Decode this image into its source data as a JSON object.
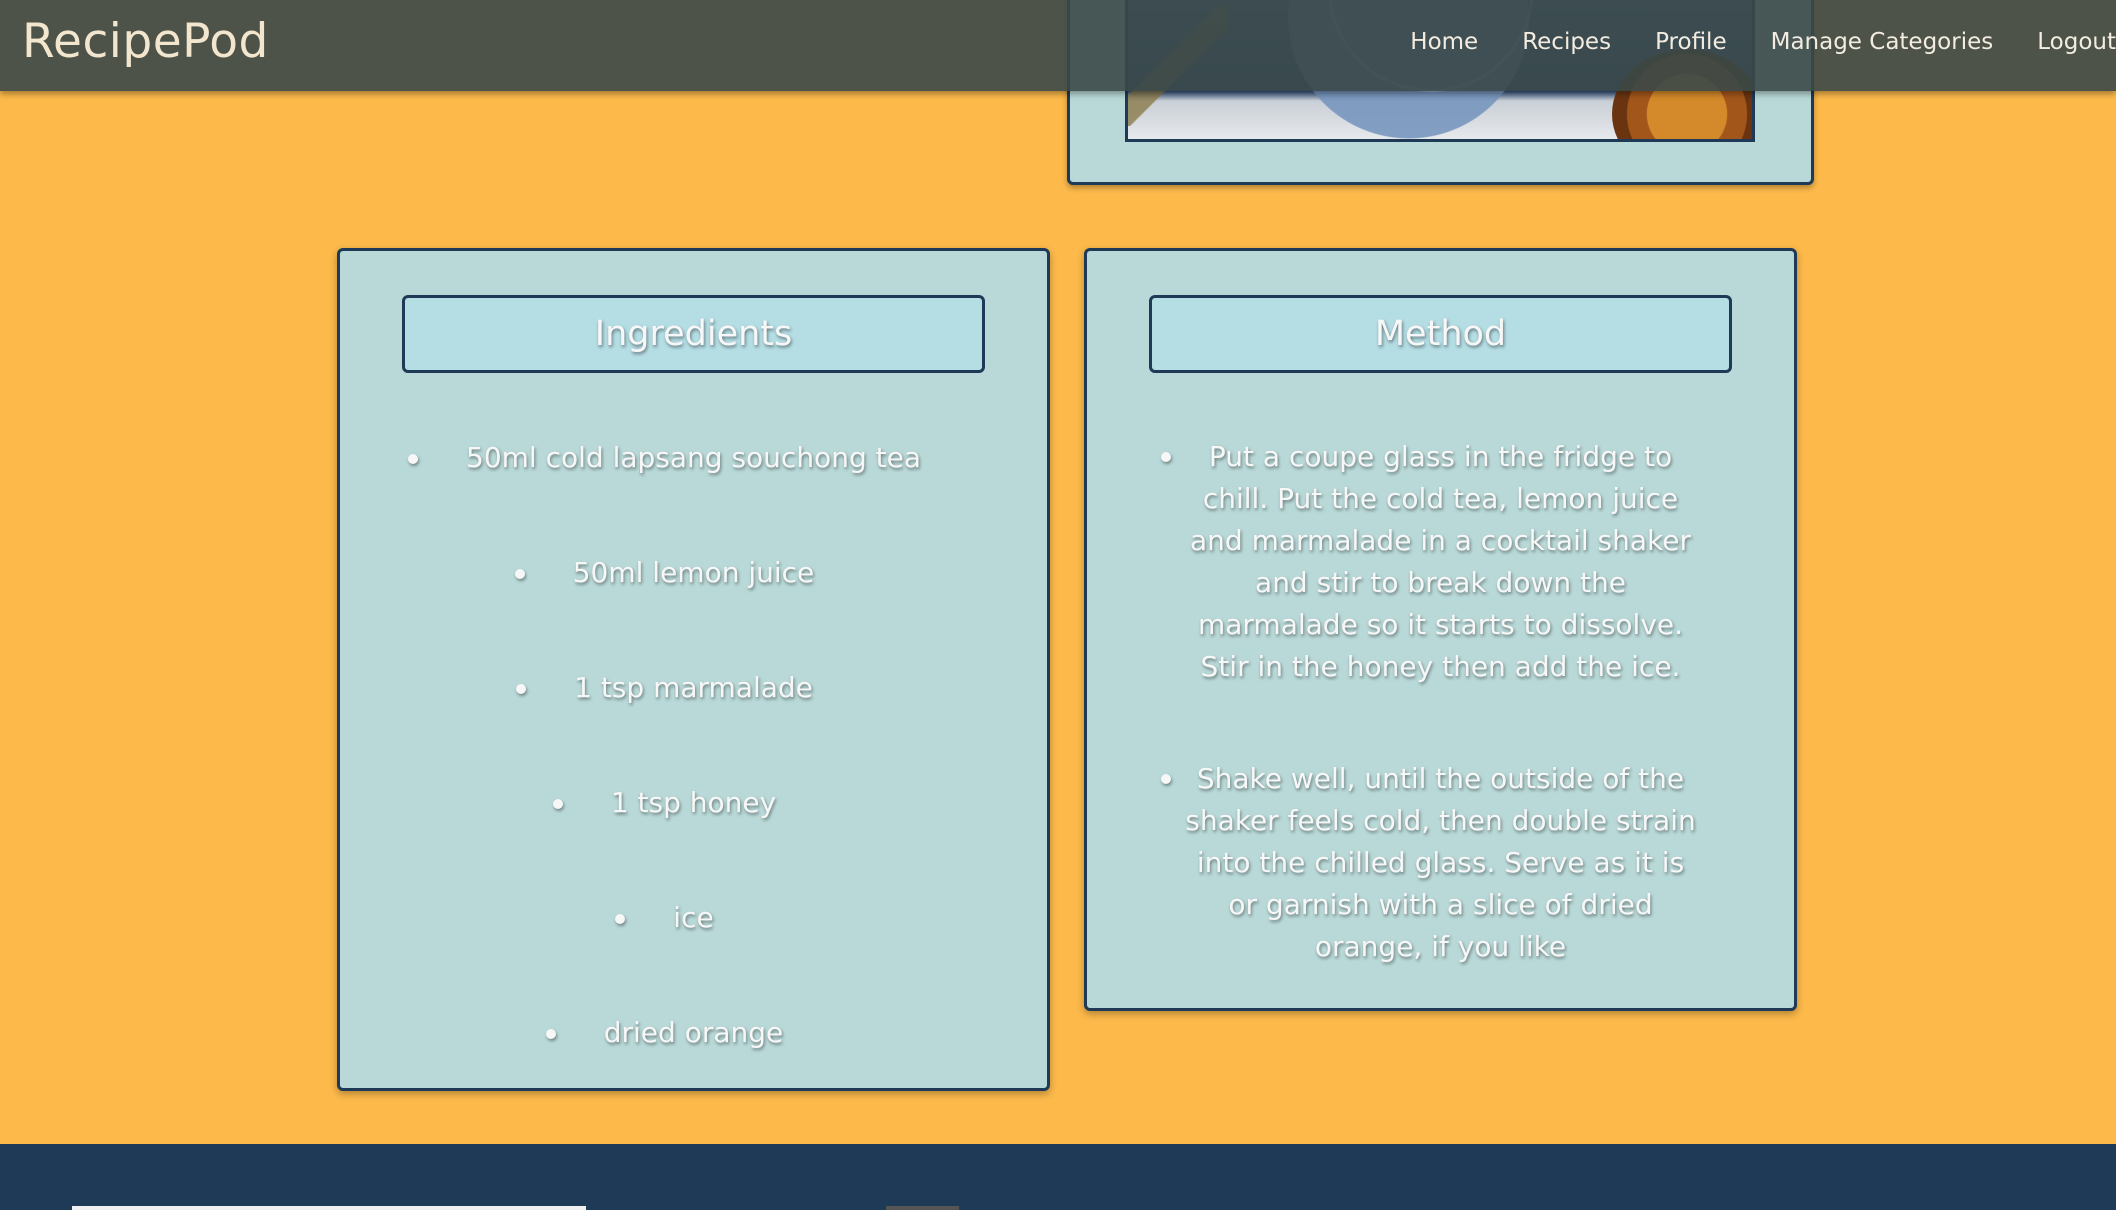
{
  "navbar": {
    "brand": "RecipePod",
    "links": [
      "Home",
      "Recipes",
      "Profile",
      "Manage Categories",
      "Logout"
    ]
  },
  "ingredients": {
    "heading": "Ingredients",
    "items": [
      "50ml cold lapsang souchong tea",
      "50ml lemon juice",
      "1 tsp marmalade",
      "1 tsp honey",
      "ice",
      "dried orange"
    ]
  },
  "method": {
    "heading": "Method",
    "steps": [
      "Put a coupe glass in the fridge to chill. Put the cold tea, lemon juice and marmalade in a cocktail shaker and stir to break down the marmalade so it starts to dissolve. Stir in the honey then add the ice.",
      "Shake well, until the outside of the shaker feels cold, then double strain into the chilled glass. Serve as it is or garnish with a slice of dried orange, if you like"
    ]
  },
  "colors": {
    "page_background": "#fdba4b",
    "card_background": "#b9d9d8",
    "heading_background": "#b4dde4",
    "border": "#1e3a56",
    "navbar": "#3a4848",
    "footer": "#1e3a56"
  }
}
